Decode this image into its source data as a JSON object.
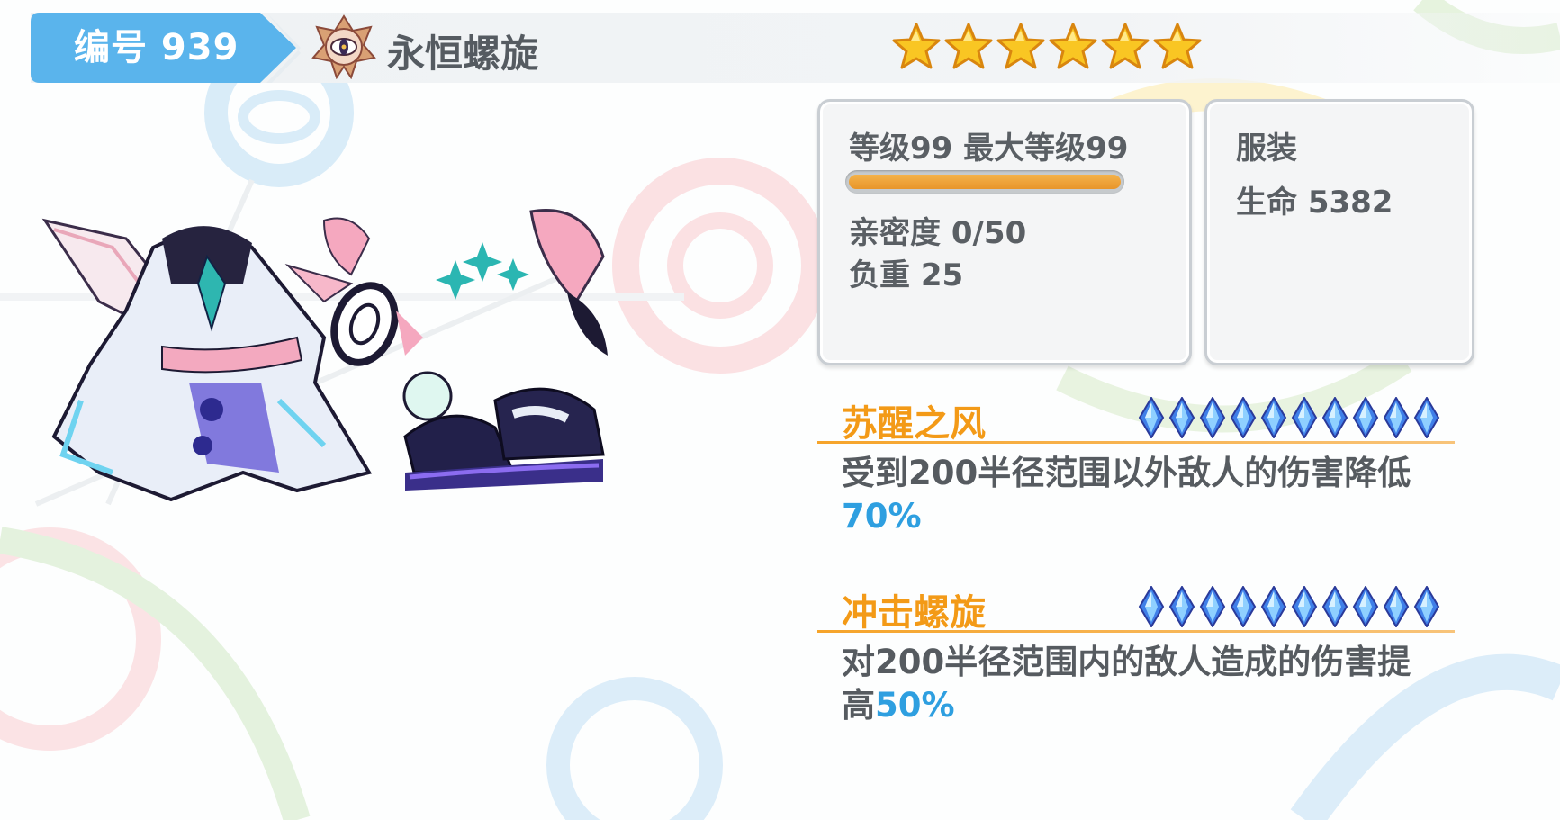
{
  "header": {
    "id_label": "编号 939",
    "item_name": "永恒螺旋",
    "star_count": 6,
    "emblem_icon": "eye-emblem-icon",
    "star_icon": "star-icon"
  },
  "stats_panel": {
    "level_text": "等级99 最大等级99",
    "level_progress": 1.0,
    "intimacy_text": "亲密度 0/50",
    "weight_text": "负重 25"
  },
  "type_panel": {
    "category": "服装",
    "hp_text": "生命 5382"
  },
  "skills": [
    {
      "name": "苏醒之风",
      "level_gems": 10,
      "desc_main": "受到200半径范围以外敌人的伤害降低",
      "desc_value": "70%"
    },
    {
      "name": "冲击螺旋",
      "level_gems": 10,
      "desc_main": "对200半径范围内的敌人造成的伤害提高",
      "desc_value": "50%"
    }
  ],
  "colors": {
    "tag_blue": "#5ab4ec",
    "skill_orange": "#f39a17",
    "highlight_blue": "#2e9fe0",
    "bar_orange": "#eca03a",
    "gem_blue": "#3f7fe8"
  }
}
